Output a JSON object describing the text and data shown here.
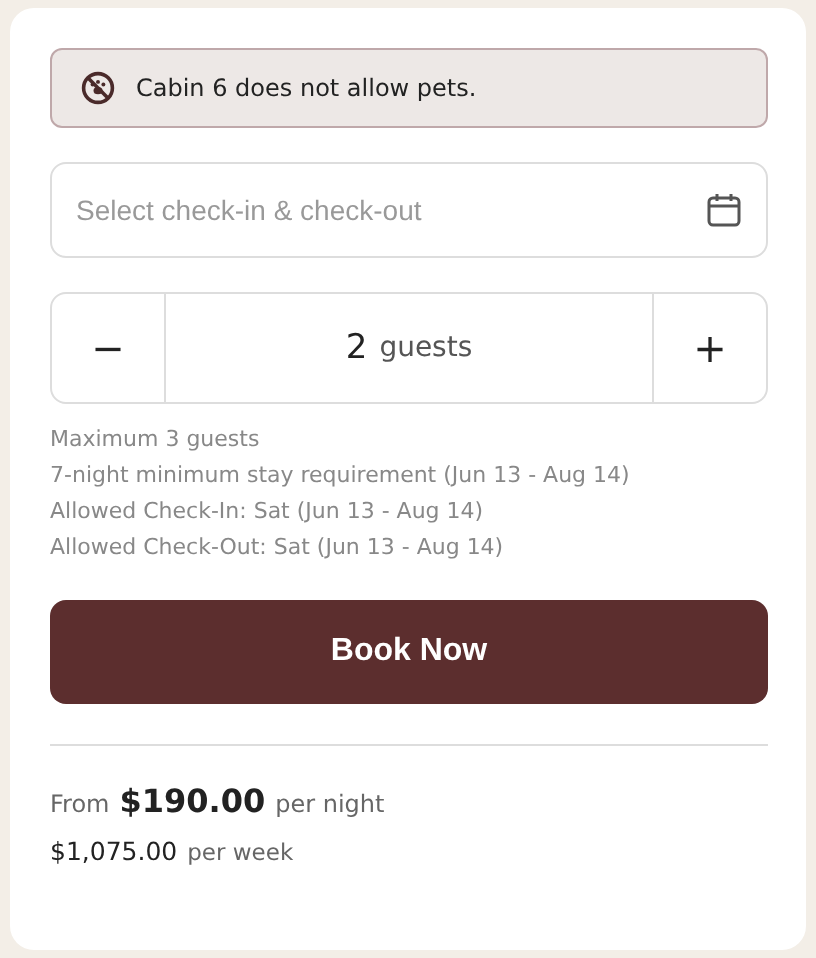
{
  "notice": {
    "text": "Cabin 6 does not allow pets."
  },
  "dates": {
    "placeholder": "Select check-in & check-out"
  },
  "guests": {
    "decrement": "−",
    "count": "2",
    "unit": "guests",
    "increment": "+"
  },
  "notes": [
    "Maximum 3 guests",
    "7-night minimum stay requirement (Jun 13 - Aug 14)",
    "Allowed Check-In: Sat (Jun 13 - Aug 14)",
    "Allowed Check-Out: Sat (Jun 13 - Aug 14)"
  ],
  "button": "Book Now",
  "pricing": {
    "prefix": "From",
    "nightly": "$190.00",
    "nightly_unit": "per night",
    "weekly": "$1,075.00",
    "weekly_unit": "per week"
  }
}
